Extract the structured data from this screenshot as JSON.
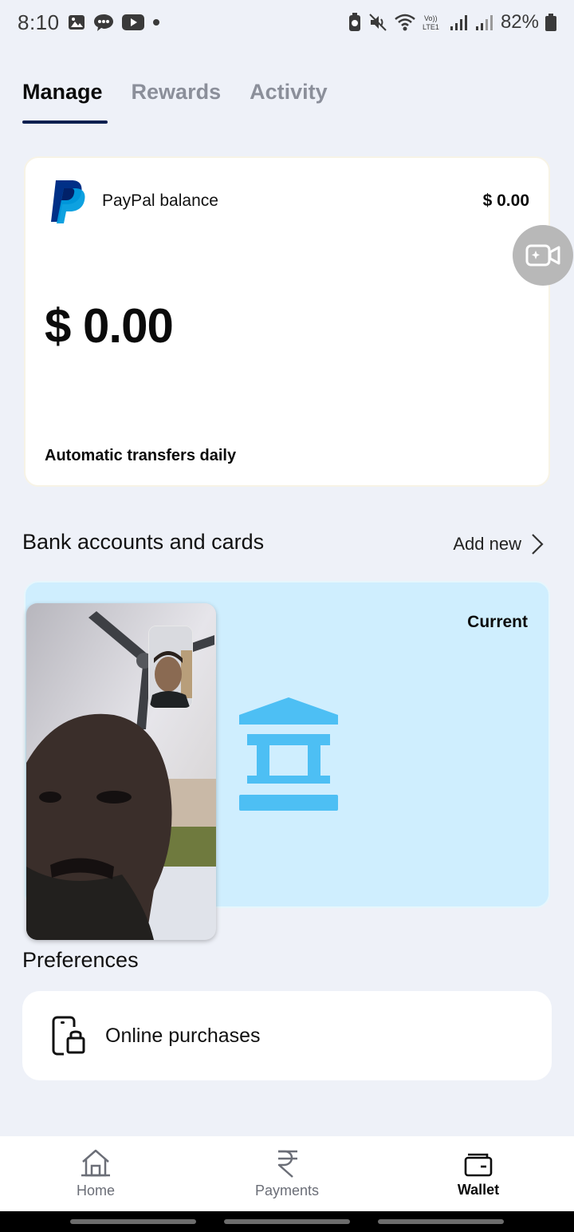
{
  "status_bar": {
    "time": "8:10",
    "battery": "82%",
    "left_icons": [
      "gallery-icon",
      "message-icon",
      "youtube-icon",
      "dot-icon"
    ],
    "right_icons": [
      "battery-saver-icon",
      "mute-icon",
      "wifi-icon",
      "volte-icon",
      "signal-icon",
      "signal-icon-2",
      "battery-icon"
    ]
  },
  "tabs": [
    {
      "label": "Manage",
      "active": true
    },
    {
      "label": "Rewards",
      "active": false
    },
    {
      "label": "Activity",
      "active": false
    }
  ],
  "balance_card": {
    "label": "PayPal balance",
    "small_amount": "$ 0.00",
    "big_amount": "$ 0.00",
    "transfers_text": "Automatic transfers daily"
  },
  "bank_section": {
    "title": "Bank accounts and cards",
    "add_new": "Add new",
    "card": {
      "account_type": "Current",
      "card_color": "#cfeefe",
      "icon_color": "#4dbff4"
    }
  },
  "preferences": {
    "title": "Preferences",
    "items": [
      {
        "label": "Online purchases",
        "icon": "phone-lock-icon"
      }
    ]
  },
  "bottom_nav": [
    {
      "label": "Home",
      "icon": "home-icon",
      "active": false
    },
    {
      "label": "Payments",
      "icon": "rupee-icon",
      "active": false
    },
    {
      "label": "Wallet",
      "icon": "wallet-icon",
      "active": true
    }
  ],
  "colors": {
    "background": "#eef1f8",
    "tab_underline": "#0b1f4f",
    "paypal_dark": "#003087",
    "paypal_light": "#009cde"
  }
}
